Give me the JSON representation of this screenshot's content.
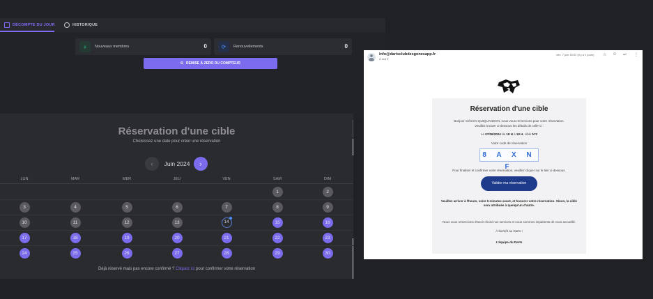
{
  "tabs": [
    {
      "label": "DÉCOMPTE DU JOUR",
      "active": true
    },
    {
      "label": "HISTORIQUE",
      "active": false
    }
  ],
  "stats": {
    "new_members_label": "Nouveaux membres",
    "new_members_value": "0",
    "renewals_label": "Renouvellements",
    "renewals_value": "0"
  },
  "reset_button": "REMISE À ZERO DU COMPTEUR",
  "reservation": {
    "title": "Réservation d'une cible",
    "subtitle": "Choisissez une date pour créer une réservation",
    "month_label": "Juin 2024",
    "prev_icon": "chevron-left-icon",
    "next_icon": "chevron-right-icon",
    "weekdays": [
      "LUN",
      "MAR",
      "MER",
      "JEU",
      "VEN",
      "SAM",
      "DIM"
    ],
    "weeks": [
      [
        null,
        null,
        null,
        null,
        null,
        1,
        2
      ],
      [
        3,
        4,
        5,
        6,
        7,
        8,
        9
      ],
      [
        10,
        11,
        12,
        13,
        14,
        15,
        16
      ],
      [
        17,
        18,
        19,
        20,
        21,
        22,
        23
      ],
      [
        24,
        25,
        26,
        27,
        28,
        29,
        30
      ]
    ],
    "today": 14,
    "first_available": 15,
    "footer_text": "Déjà réservé mais pas encore confirmé ?",
    "footer_link": "Cliquez ici",
    "footer_after": "pour confirmer votre réservation"
  },
  "email": {
    "from": "info@dartsclubdesgonesapp.fr",
    "to": "À moi ▾",
    "date": "ven. 7 juin 16:02 (il y a 1 jours)",
    "title": "Réservation d'une cible",
    "greeting": "Bonjour Clément QUIQUANDON, nous vous remercions pour votre réservation.",
    "details_intro": "Veuillez trouver ci-dessous les détails de celle-ci :",
    "booking_prefix": "Le",
    "booking_date": "07/06/2024",
    "booking_from_word": "de",
    "booking_start": "18 H",
    "booking_to_word": "à",
    "booking_end": "19 H",
    "booking_target_word": ", cible",
    "booking_target": "N°2",
    "code_label": "Votre code de réservation",
    "code": "8AXNF",
    "finalize_text": "Pour finaliser et confirmer votre réservation, veuillez cliquer sur le lien ci-dessous.",
    "validate_button": "Valider ma réservation",
    "warning": "Veuillez arriver à l'heure, voire 5 minutes avant, et honorer votre réservation. Sinon, la cible sera attribuée à quelqu'un d'autre.",
    "thanks": "Nous vous remercions d'avoir choisi nos services et nous sommes impatients de vous accueillir.",
    "bientot": "À bientôt au Darts !",
    "signature": "L'équipe du Darts",
    "icons": [
      "star-icon",
      "emoji-icon",
      "reply-icon",
      "more-icon"
    ]
  },
  "colors": {
    "accent": "#7a6ced",
    "today_ring": "#5a7dd6",
    "email_button": "#1e3a8a",
    "code_text": "#2e6bd6"
  }
}
